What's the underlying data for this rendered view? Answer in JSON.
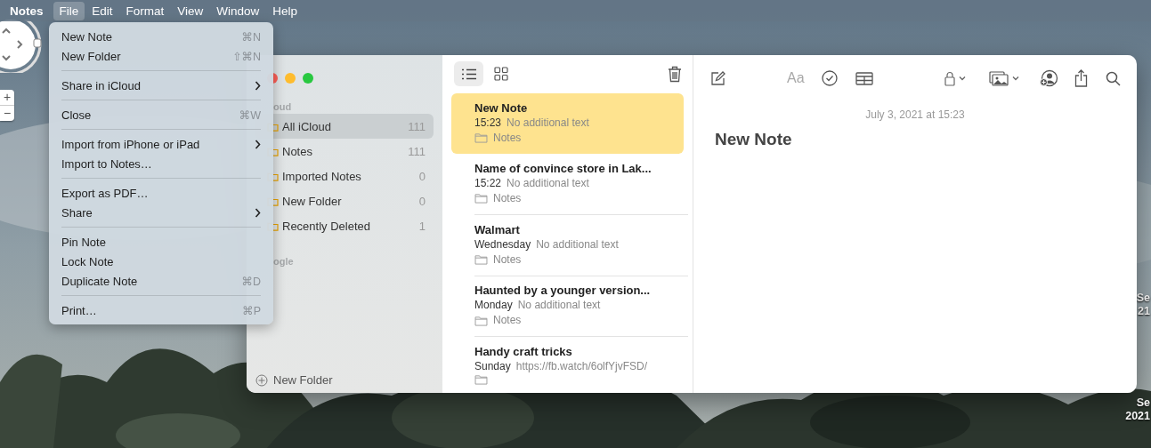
{
  "menu_bar": {
    "app": "Notes",
    "items": [
      {
        "label": "File",
        "selected": true
      },
      {
        "label": "Edit",
        "selected": false
      },
      {
        "label": "Format",
        "selected": false
      },
      {
        "label": "View",
        "selected": false
      },
      {
        "label": "Window",
        "selected": false
      },
      {
        "label": "Help",
        "selected": false
      }
    ]
  },
  "file_menu": {
    "groups": [
      [
        {
          "label": "New Note",
          "shortcut": "⌘N",
          "has_submenu": false
        },
        {
          "label": "New Folder",
          "shortcut": "⇧⌘N",
          "has_submenu": false
        }
      ],
      [
        {
          "label": "Share in iCloud",
          "has_submenu": true
        }
      ],
      [
        {
          "label": "Close",
          "shortcut": "⌘W",
          "has_submenu": false
        }
      ],
      [
        {
          "label": "Import from iPhone or iPad",
          "has_submenu": true
        },
        {
          "label": "Import to Notes…",
          "has_submenu": false
        }
      ],
      [
        {
          "label": "Export as PDF…",
          "has_submenu": false
        },
        {
          "label": "Share",
          "has_submenu": true
        }
      ],
      [
        {
          "label": "Pin Note",
          "has_submenu": false
        },
        {
          "label": "Lock Note",
          "has_submenu": false
        },
        {
          "label": "Duplicate Note",
          "shortcut": "⌘D",
          "has_submenu": false
        }
      ],
      [
        {
          "label": "Print…",
          "shortcut": "⌘P",
          "has_submenu": false
        }
      ]
    ]
  },
  "map_controls": {
    "zoom_in": "+",
    "zoom_out": "−"
  },
  "desktop_labels": [
    {
      "line1": "Se",
      "line2": "21"
    },
    {
      "line1": "Se",
      "line2": "2021"
    }
  ],
  "notes_window": {
    "sidebar": {
      "sections": [
        {
          "header": "oud",
          "folders": [
            {
              "name": "All iCloud",
              "count": "111",
              "selected": true
            },
            {
              "name": "Notes",
              "count": "111",
              "selected": false
            },
            {
              "name": "Imported Notes",
              "count": "0",
              "selected": false
            },
            {
              "name": "New Folder",
              "count": "0",
              "selected": false
            },
            {
              "name": "Recently Deleted",
              "count": "1",
              "selected": false
            }
          ]
        },
        {
          "header": "ogle"
        }
      ],
      "new_folder_button": "New Folder"
    },
    "note_list": {
      "view_modes": [
        {
          "kind": "list",
          "selected": true
        },
        {
          "kind": "gallery",
          "selected": false
        }
      ],
      "notes": [
        {
          "title": "New Note",
          "time": "15:23",
          "preview": "No additional text",
          "folder": "Notes",
          "selected": true
        },
        {
          "title": "Name of convince store in Lak...",
          "time": "15:22",
          "preview": "No additional text",
          "folder": "Notes",
          "selected": false
        },
        {
          "title": "Walmart",
          "time": "Wednesday",
          "preview": "No additional text",
          "folder": "Notes",
          "selected": false
        },
        {
          "title": "Haunted by a younger version...",
          "time": "Monday",
          "preview": "No additional text",
          "folder": "Notes",
          "selected": false
        },
        {
          "title": "Handy craft tricks",
          "time": "Sunday",
          "preview": "https://fb.watch/6olfYjvFSD/",
          "selected": false
        }
      ]
    },
    "editor": {
      "date": "July 3, 2021 at 15:23",
      "title": "New Note",
      "format_button": "Aa"
    }
  }
}
